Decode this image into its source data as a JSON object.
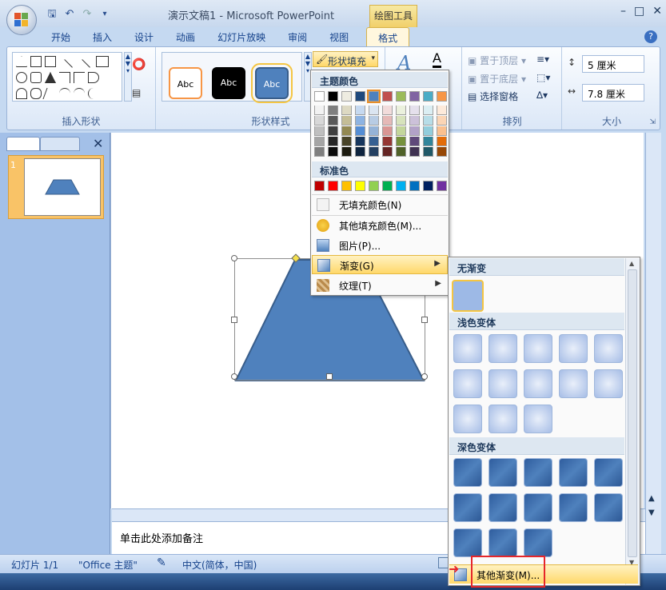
{
  "title_bar": {
    "app_title": "演示文稿1 - Microsoft PowerPoint",
    "tool_context": "绘图工具"
  },
  "tabs": [
    "开始",
    "插入",
    "设计",
    "动画",
    "幻灯片放映",
    "审阅",
    "视图",
    "格式"
  ],
  "active_tab": "格式",
  "ribbon": {
    "groups": {
      "insert_shapes": "插入形状",
      "shape_styles": "形状样式",
      "arrange": "排列",
      "size": "大小"
    },
    "style_samples": [
      "Abc",
      "Abc",
      "Abc"
    ],
    "shape_fill": "形状填充",
    "bring_to_front": "置于顶层",
    "send_to_back": "置于底层",
    "selection_pane": "选择窗格",
    "height": "5 厘米",
    "width": "7.8 厘米"
  },
  "slide_panel": {
    "slide_number": "1"
  },
  "notes_placeholder": "单击此处添加备注",
  "status_bar": {
    "slide": "幻灯片 1/1",
    "theme": "\"Office 主题\"",
    "language": "中文(简体，中国)"
  },
  "fill_menu": {
    "theme_colors": "主题颜色",
    "standard_colors": "标准色",
    "no_fill": "无填充颜色(N)",
    "more_colors": "其他填充颜色(M)...",
    "picture": "图片(P)...",
    "gradient": "渐变(G)",
    "texture": "纹理(T)"
  },
  "theme_colors_top": [
    "#ffffff",
    "#000000",
    "#eeece1",
    "#1f497d",
    "#4f81bd",
    "#c0504d",
    "#9bbb59",
    "#8064a2",
    "#4bacc6",
    "#f79646"
  ],
  "theme_colors_shades": [
    [
      "#f2f2f2",
      "#7f7f7f",
      "#ddd9c3",
      "#c6d9f0",
      "#dbe5f1",
      "#f2dcdb",
      "#ebf1dd",
      "#e5e0ec",
      "#dbeef3",
      "#fdeada"
    ],
    [
      "#d8d8d8",
      "#595959",
      "#c4bd97",
      "#8db3e2",
      "#b8cce4",
      "#e5b9b7",
      "#d7e3bc",
      "#ccc1d9",
      "#b7dde8",
      "#fbd5b5"
    ],
    [
      "#bfbfbf",
      "#3f3f3f",
      "#938953",
      "#548dd4",
      "#95b3d7",
      "#d99694",
      "#c3d69b",
      "#b2a2c7",
      "#92cddc",
      "#fac08f"
    ],
    [
      "#a5a5a5",
      "#262626",
      "#494429",
      "#17365d",
      "#366092",
      "#953734",
      "#76923c",
      "#5f497a",
      "#31859b",
      "#e36c09"
    ],
    [
      "#7f7f7f",
      "#0c0c0c",
      "#1d1b10",
      "#0f243e",
      "#244061",
      "#632423",
      "#4f6128",
      "#3f3151",
      "#205867",
      "#974806"
    ]
  ],
  "standard_colors": [
    "#c00000",
    "#ff0000",
    "#ffc000",
    "#ffff00",
    "#92d050",
    "#00b050",
    "#00b0f0",
    "#0070c0",
    "#002060",
    "#7030a0"
  ],
  "gradient_menu": {
    "no_gradient": "无渐变",
    "light_variations": "浅色变体",
    "dark_variations": "深色变体",
    "more_gradients": "其他渐变(M)..."
  },
  "colors": {
    "shape_fill": "#4f81bd",
    "shape_border": "#385d8a",
    "accent_red": "#e6262a"
  }
}
